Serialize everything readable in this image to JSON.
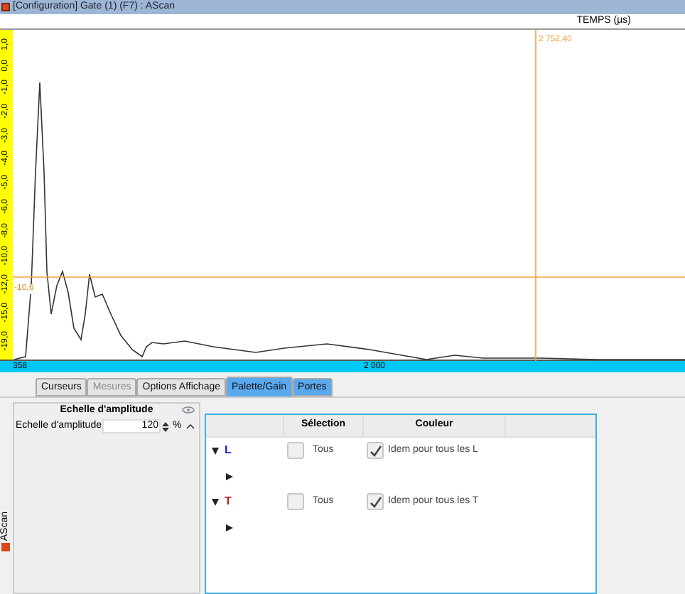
{
  "window": {
    "title": "[Configuration] Gate (1) (F7) : AScan"
  },
  "plot": {
    "axis_title": "TEMPS (µs)",
    "y_ticks": [
      "1,0",
      "0,0",
      "-1,0",
      "-2,0",
      "-3,0",
      "-4,0",
      "-5,0",
      "-6,0",
      "-8,0",
      "-10,0",
      "-12,0",
      "-15,0",
      "-19,0"
    ],
    "x_ticks": [
      "358",
      "2 000"
    ],
    "cursor_x_label": "2 752,40",
    "cursor_y_label": "-10,6"
  },
  "tabs": [
    {
      "label": "Curseurs",
      "selected": false,
      "disabled": false,
      "highlighted": false
    },
    {
      "label": "Mesures",
      "selected": false,
      "disabled": true,
      "highlighted": false
    },
    {
      "label": "Options Affichage",
      "selected": false,
      "disabled": false,
      "highlighted": false
    },
    {
      "label": "Palette/Gain",
      "selected": true,
      "disabled": false,
      "highlighted": true
    },
    {
      "label": "Portes",
      "selected": false,
      "disabled": false,
      "highlighted": true
    }
  ],
  "amplitude_panel": {
    "title": "Echelle d'amplitude",
    "label": "Echelle d'amplitude",
    "value": "120",
    "unit": "%"
  },
  "table": {
    "columns": [
      "Sélection",
      "Couleur"
    ],
    "groups": [
      {
        "name": "L",
        "color": "#1a1acc",
        "expanded": true,
        "all_label": "Tous",
        "all_checked": false,
        "same_label": "Idem pour tous les L",
        "same_checked": true,
        "child_expanded": false
      },
      {
        "name": "T",
        "color": "#cc1a1a",
        "expanded": true,
        "all_label": "Tous",
        "all_checked": false,
        "same_label": "Idem pour tous les T",
        "same_checked": true,
        "child_expanded": false
      }
    ]
  },
  "side_tab": {
    "label": "AScan"
  }
}
